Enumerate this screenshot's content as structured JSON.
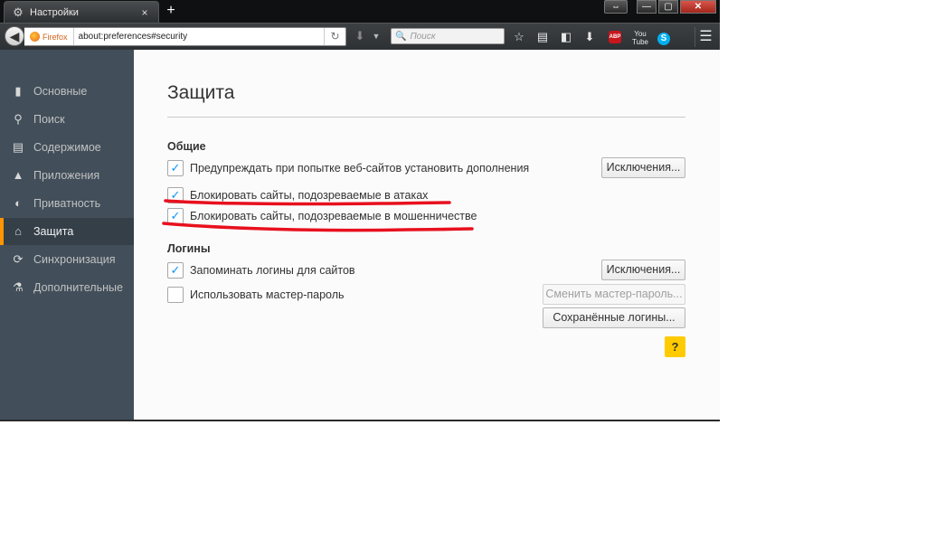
{
  "window": {
    "tab_title": "Настройки",
    "tab_close": "×",
    "newtab_label": "+",
    "controls": {
      "resize": "⇔",
      "minimize": "—",
      "maximize": "▢",
      "close": "✕"
    }
  },
  "navbar": {
    "identity": "Firefox",
    "url": "about:preferences#security",
    "search_placeholder": "Поиск"
  },
  "sidebar": {
    "items": [
      {
        "label": "Основные",
        "icon": "general-icon"
      },
      {
        "label": "Поиск",
        "icon": "search-icon"
      },
      {
        "label": "Содержимое",
        "icon": "content-icon"
      },
      {
        "label": "Приложения",
        "icon": "applications-icon"
      },
      {
        "label": "Приватность",
        "icon": "privacy-mask-icon"
      },
      {
        "label": "Защита",
        "icon": "security-lock-icon"
      },
      {
        "label": "Синхронизация",
        "icon": "sync-icon"
      },
      {
        "label": "Дополнительные",
        "icon": "advanced-wizard-icon"
      }
    ],
    "active_index": 5
  },
  "main": {
    "title": "Защита",
    "general": {
      "heading": "Общие",
      "warn_addons": {
        "label": "Предупреждать при попытке веб-сайтов установить дополнения",
        "checked": true
      },
      "exceptions1": "Исключения...",
      "block_attack": {
        "label": "Блокировать сайты, подозреваемые в атаках",
        "checked": true
      },
      "block_forgery": {
        "label": "Блокировать сайты, подозреваемые в мошенничестве",
        "checked": true
      }
    },
    "logins": {
      "heading": "Логины",
      "remember": {
        "label": "Запоминать логины для сайтов",
        "checked": true
      },
      "exceptions2": "Исключения...",
      "master": {
        "label": "Использовать мастер-пароль",
        "checked": false
      },
      "change_master": "Сменить мастер-пароль...",
      "saved_logins": "Сохранённые логины..."
    },
    "help": "?"
  },
  "colors": {
    "accent_active": "#ff9500",
    "checkmark": "#0996f8",
    "help_button": "#ffcb00",
    "annotation": "#e8101e"
  }
}
